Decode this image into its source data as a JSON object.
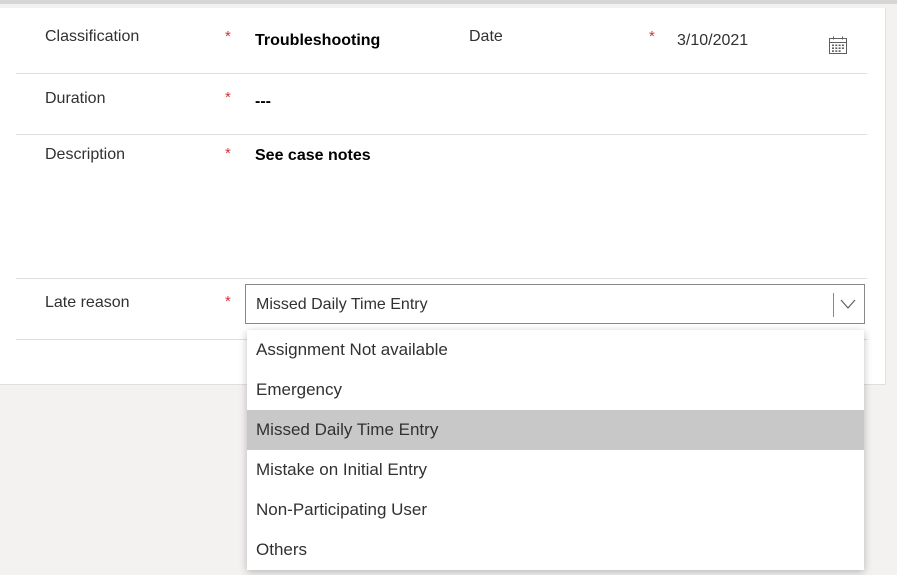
{
  "form": {
    "required_marker": "*",
    "classification": {
      "label": "Classification",
      "value": "Troubleshooting"
    },
    "date": {
      "label": "Date",
      "value": "3/10/2021",
      "icon": "calendar-icon"
    },
    "duration": {
      "label": "Duration",
      "value": "---"
    },
    "description": {
      "label": "Description",
      "value": "See case notes"
    },
    "late_reason": {
      "label": "Late reason",
      "selected": "Missed Daily Time Entry",
      "icon": "chevron-down-icon",
      "options": [
        "Assignment Not available",
        "Emergency",
        "Missed Daily Time Entry",
        "Mistake on Initial Entry",
        "Non-Participating User",
        "Others"
      ]
    }
  },
  "colors": {
    "required": "#d13438",
    "highlight": "#c8c8c8"
  }
}
